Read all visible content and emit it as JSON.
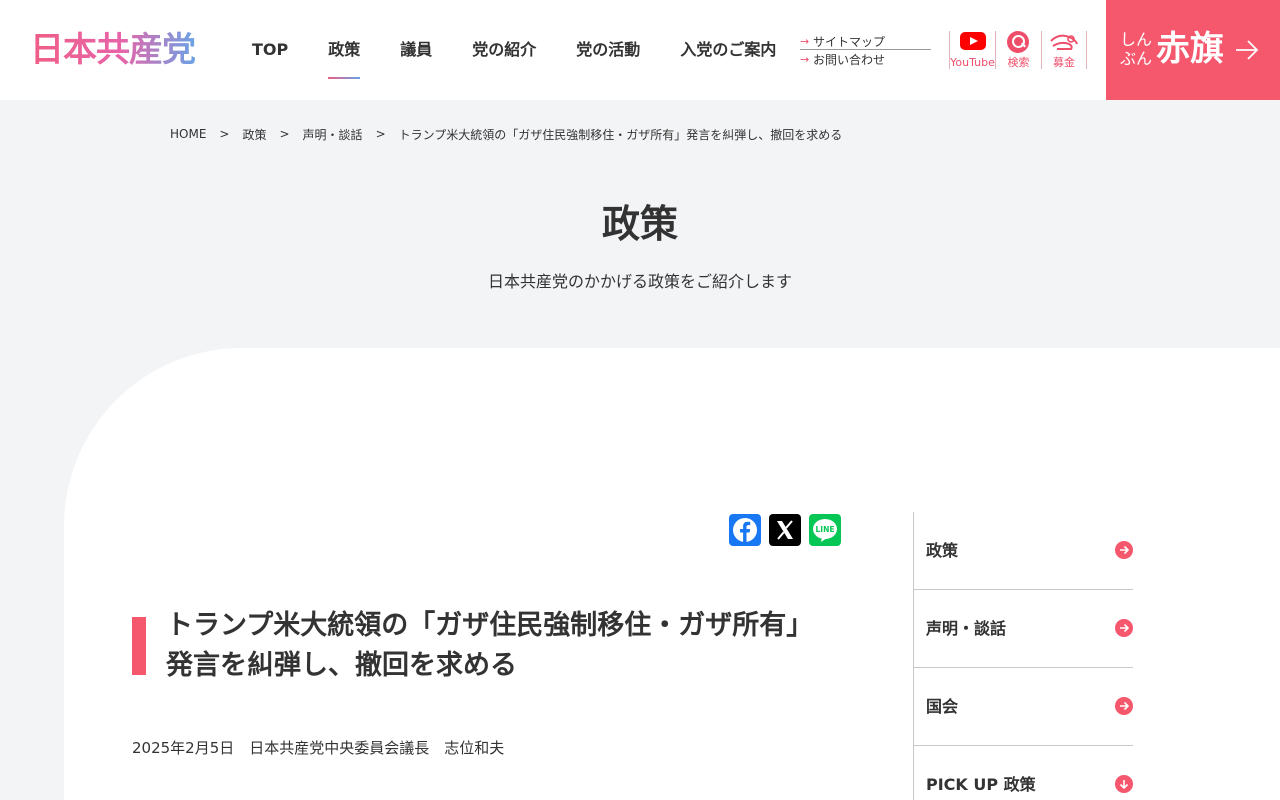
{
  "header": {
    "logo_text": "日本共産党",
    "nav": [
      {
        "label": "TOP"
      },
      {
        "label": "政策"
      },
      {
        "label": "議員"
      },
      {
        "label": "党の紹介"
      },
      {
        "label": "党の活動"
      },
      {
        "label": "入党のご案内"
      }
    ],
    "active_nav": "政策",
    "sublinks": [
      {
        "label": "サイトマップ"
      },
      {
        "label": "お問い合わせ"
      }
    ],
    "icons": [
      {
        "label": "YouTube",
        "icon": "youtube-icon"
      },
      {
        "label": "検索",
        "icon": "search-icon"
      },
      {
        "label": "募金",
        "icon": "donate-icon"
      }
    ],
    "akahata": {
      "small": "しんぶん",
      "big": "赤旗"
    }
  },
  "breadcrumb": {
    "items": [
      "HOME",
      "政策",
      "声明・談話",
      "トランプ米大統領の「ガザ住民強制移住・ガザ所有」発言を糾弾し、撤回を求める"
    ],
    "separator": ">"
  },
  "hero": {
    "title": "政策",
    "subtitle": "日本共産党のかかげる政策をご紹介します"
  },
  "share": [
    "facebook-icon",
    "x-icon",
    "line-icon"
  ],
  "share_line_text": "LINE",
  "article": {
    "title_line1": "トランプ米大統領の「ガザ住民強制移住・ガザ所有」",
    "title_line2": "発言を糾弾し、撤回を求める",
    "meta": "2025年2月5日　日本共産党中央委員会議長　志位和夫"
  },
  "side_menu": [
    {
      "label": "政策",
      "icon": "arrow-right-icon"
    },
    {
      "label": "声明・談話",
      "icon": "arrow-right-icon"
    },
    {
      "label": "国会",
      "icon": "arrow-right-icon"
    },
    {
      "label": "PICK UP 政策",
      "icon": "arrow-down-icon"
    }
  ],
  "colors": {
    "accent": "#f5576c",
    "background": "#f3f4f6",
    "youtube": "#ff0000",
    "facebook": "#1877f2",
    "line": "#06c755"
  }
}
